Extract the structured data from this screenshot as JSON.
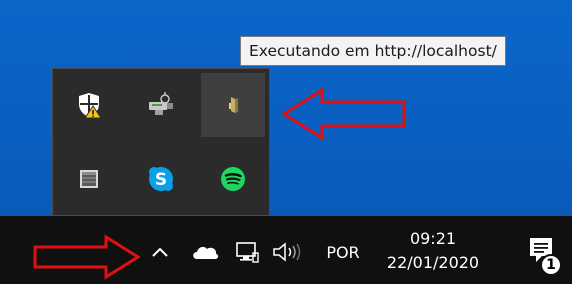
{
  "tooltip": {
    "text": "Executando em http://localhost/"
  },
  "tray_overflow": {
    "icons": [
      {
        "name": "windows-security-warning-icon"
      },
      {
        "name": "usb-safely-remove-icon"
      },
      {
        "name": "local-server-app-icon"
      },
      {
        "name": "generic-app-icon"
      },
      {
        "name": "skype-icon"
      },
      {
        "name": "spotify-icon"
      }
    ]
  },
  "taskbar": {
    "show_hidden_icons": "chevron-up-icon",
    "language": "POR",
    "clock": {
      "time": "09:21",
      "date": "22/01/2020"
    },
    "notification_badge": "1"
  },
  "colors": {
    "desktop": "#0a64c8",
    "taskbar": "#101010",
    "tray_popup": "#2b2b2b",
    "annotation_arrow": "#e01010"
  }
}
